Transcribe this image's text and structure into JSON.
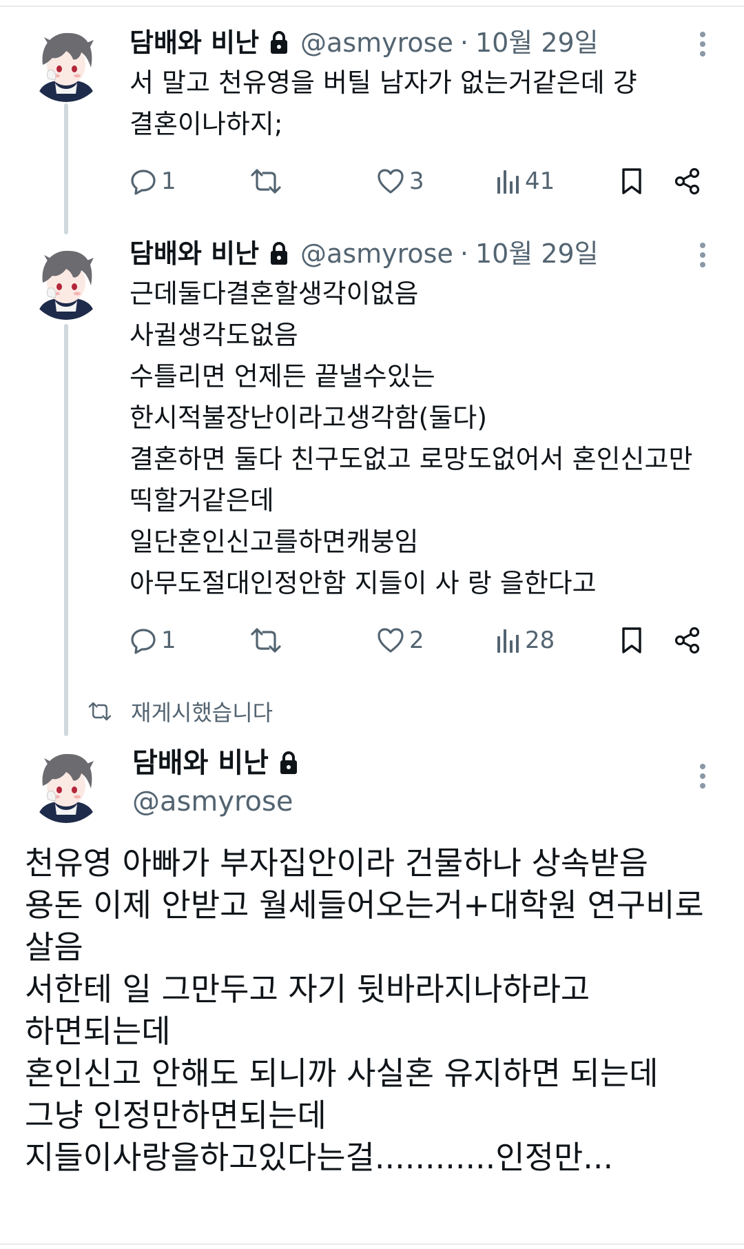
{
  "tweets": [
    {
      "display_name": "담배와 비난",
      "handle": "@asmyrose",
      "separator": "·",
      "date": "10월 29일",
      "lines": [
        "서 말고 천유영을 버틸 남자가 없는거같은데 걍",
        "결혼이나하지;"
      ],
      "replies": "1",
      "likes": "3",
      "views": "41"
    },
    {
      "display_name": "담배와 비난",
      "handle": "@asmyrose",
      "separator": "·",
      "date": "10월 29일",
      "lines": [
        "근데둘다결혼할생각이없음",
        "사귈생각도없음",
        "수틀리면 언제든 끝낼수있는",
        "한시적불장난이라고생각함(둘다)",
        "결혼하면 둘다 친구도없고 로망도없어서 혼인신고만",
        "띡할거같은데",
        "일단혼인신고를하면캐붕임",
        "아무도절대인정안함 지들이 사 랑 을한다고"
      ],
      "replies": "1",
      "likes": "2",
      "views": "28"
    }
  ],
  "retweet_label": "재게시했습니다",
  "main_tweet": {
    "display_name": "담배와 비난",
    "handle": "@asmyrose",
    "lines": [
      "천유영 아빠가 부자집안이라 건물하나 상속받음",
      "용돈 이제 안받고 월세들어오는거+대학원 연구비로",
      "살음",
      "서한테 일 그만두고 자기 뒷바라지나하라고",
      "하면되는데",
      "혼인신고 안해도 되니까 사실혼 유지하면 되는데",
      "그냥 인정만하면되는데",
      "지들이사랑을하고있다는걸............인정만..."
    ]
  },
  "icons": {
    "reply": "reply-icon",
    "retweet": "retweet-icon",
    "like": "heart-icon",
    "views": "views-icon",
    "bookmark": "bookmark-icon",
    "share": "share-icon",
    "lock": "lock-icon",
    "more": "more-dots-icon"
  },
  "colors": {
    "text": "#0f1419",
    "secondary": "#536471",
    "thread_line": "#cfd9de"
  }
}
